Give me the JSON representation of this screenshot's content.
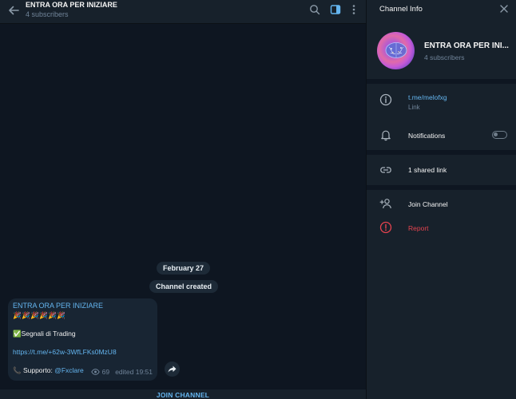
{
  "chat": {
    "title": "ENTRA ORA PER INIZIARE",
    "subtitle": "4 subscribers",
    "date_label": "February 27",
    "created_label": "Channel created",
    "join_label": "JOIN CHANNEL",
    "message": {
      "author": "ENTRA ORA PER INIZIARE",
      "emoji_line": "🎉🎉🎉🎉🎉🎉",
      "signal_text": "✅Segnali di Trading",
      "link": "https://t.me/+62w-3WfLFKs0MzU8",
      "support_prefix": "📞 Supporto:",
      "support_handle": "@Fxclare",
      "views": "69",
      "edited": "edited 19:51"
    }
  },
  "info": {
    "title": "Channel Info",
    "name": "ENTRA ORA PER INI...",
    "subscribers": "4 subscribers",
    "link": "t.me/melofxg",
    "link_caption": "Link",
    "notifications_label": "Notifications",
    "notifications_enabled": false,
    "shared_links": "1 shared link",
    "join_label": "Join Channel",
    "report_label": "Report"
  },
  "icons": {
    "back": "arrow-left-icon",
    "search": "search-icon",
    "panel": "sidebar-panel-icon",
    "more": "more-vertical-icon",
    "close": "close-icon",
    "info": "info-icon",
    "bell": "bell-icon",
    "link": "link-icon",
    "add_user": "add-user-icon",
    "report": "report-icon",
    "forward": "forward-icon",
    "eye": "eye-icon"
  },
  "colors": {
    "accent": "#64b5ef",
    "danger": "#e5434f",
    "chat_bg": "#0e1621",
    "panel_bg": "#17212b",
    "bubble_bg": "#182533"
  }
}
